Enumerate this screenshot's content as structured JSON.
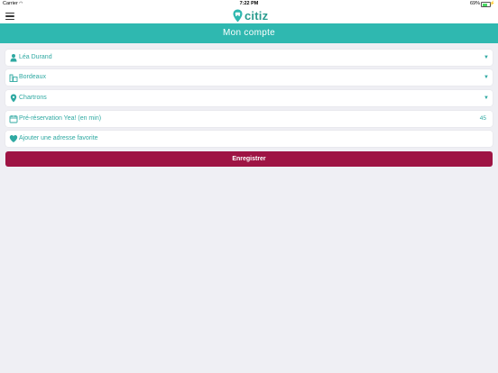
{
  "status_bar": {
    "carrier": "Carrier",
    "time": "7:22 PM",
    "battery": "69%",
    "battery_level": 0.69
  },
  "header": {
    "logo_text": "citiz",
    "menu_icon": "hamburger-menu-icon"
  },
  "title": "Mon compte",
  "fields": [
    {
      "icon": "user-icon",
      "label": "Léa Durand",
      "control": "dropdown-arrow"
    },
    {
      "icon": "city-buildings-icon",
      "label": "Bordeaux",
      "control": "dropdown-arrow"
    },
    {
      "icon": "location-pin-icon",
      "label": "Chartrons",
      "control": "dropdown-arrow"
    },
    {
      "icon": "calendar-icon",
      "label": "Pré-réservation Yea! (en min)",
      "value": "45"
    },
    {
      "icon": "heart-icon",
      "label": "Ajouter une adresse favorite"
    }
  ],
  "save_button": {
    "label": "Enregistrer"
  },
  "colors": {
    "accent": "#2fb8b0",
    "text_accent": "#2fa9a2",
    "button": "#9e1444",
    "background": "#efeff4",
    "logo": "#2a9c8f"
  }
}
